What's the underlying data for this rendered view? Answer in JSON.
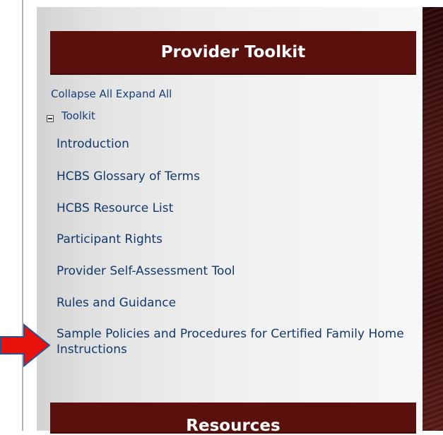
{
  "toolkit": {
    "header": "Provider Toolkit",
    "collapse_all": "Collapse All",
    "expand_all": "Expand All",
    "tree_root": "Toolkit",
    "items": [
      "Introduction",
      "HCBS Glossary of Terms",
      "HCBS Resource List",
      "Participant Rights",
      "Provider Self-Assessment Tool",
      "Rules and Guidance",
      "Sample Policies and Procedures for Certified Family Home Instructions"
    ]
  },
  "resources": {
    "header": "Resources"
  },
  "colors": {
    "header_bg": "#5a100c",
    "link": "#14396b",
    "arrow_fill": "#e8120c",
    "arrow_stroke": "#2e4f8f"
  },
  "icons": {
    "tree_toggle": "minus-box-icon",
    "pointer": "right-arrow-icon"
  }
}
